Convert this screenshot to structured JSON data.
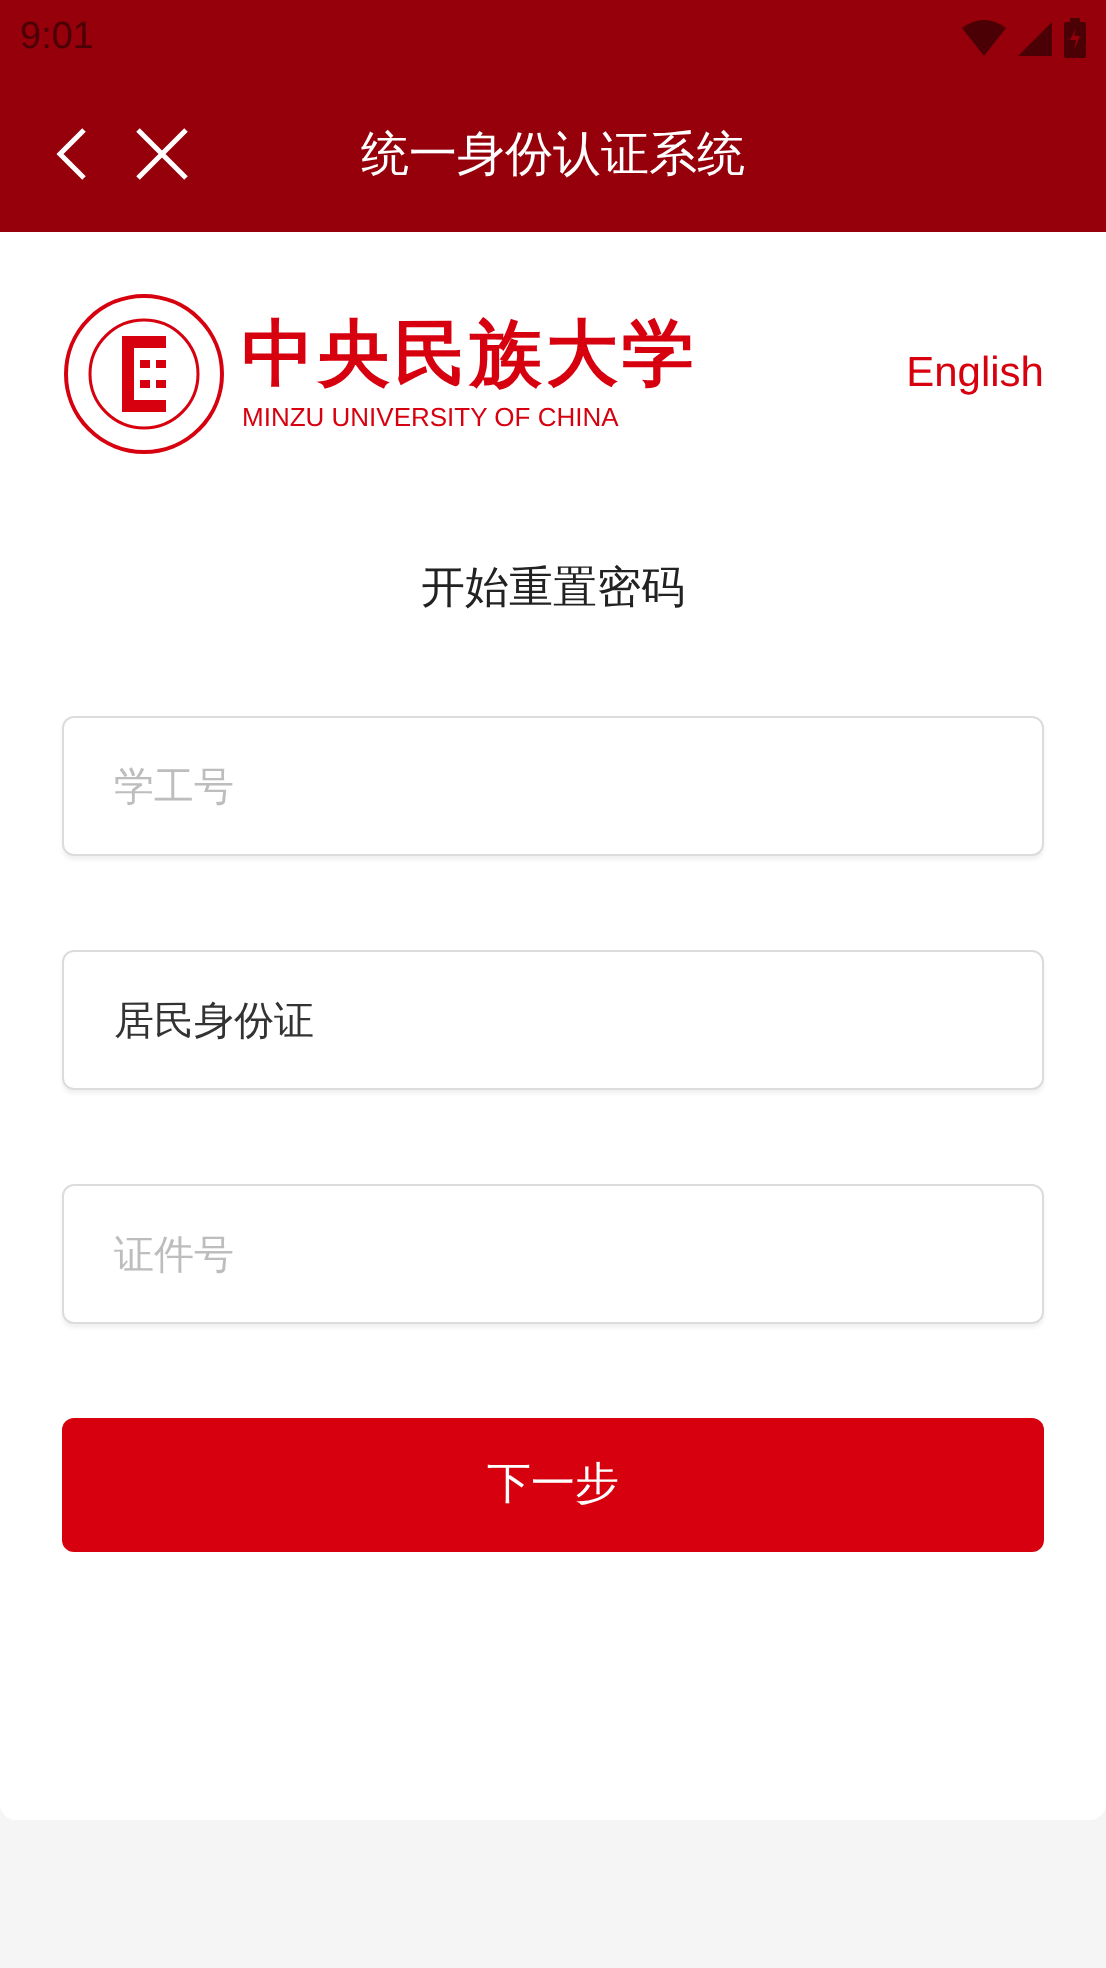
{
  "status_bar": {
    "time": "9:01"
  },
  "header": {
    "title": "统一身份认证系统"
  },
  "logo": {
    "name_cn": "中央民族大学",
    "name_en": "MINZU UNIVERSITY OF CHINA"
  },
  "language_link": "English",
  "form": {
    "heading": "开始重置密码",
    "fields": [
      {
        "kind": "input",
        "placeholder": "学工号"
      },
      {
        "kind": "select",
        "value": "居民身份证"
      },
      {
        "kind": "input",
        "placeholder": "证件号"
      }
    ],
    "submit": "下一步"
  }
}
